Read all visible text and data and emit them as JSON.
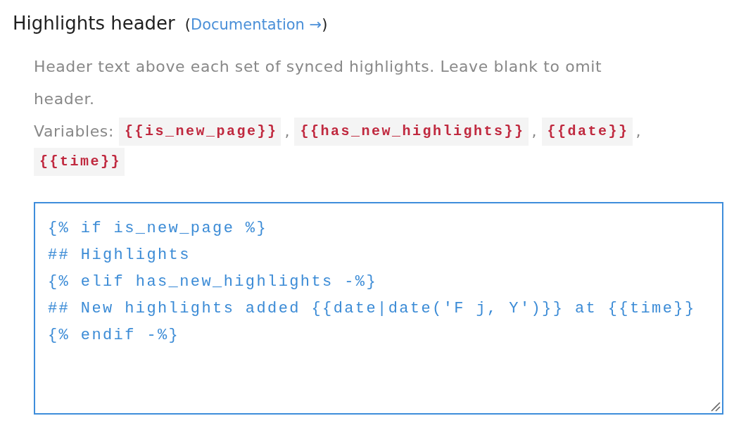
{
  "field": {
    "label": "Highlights header",
    "doc_note": {
      "before": "(",
      "link": "Documentation →",
      "after": ")"
    },
    "description": "Header text above each set of synced highlights. Leave blank to omit header.",
    "variables": {
      "label": "Variables:",
      "items": [
        {
          "code": "{{is_new_page}}",
          "separator": ","
        },
        {
          "code": "{{has_new_highlights}}",
          "separator": ","
        },
        {
          "code": "{{date}}",
          "separator": ","
        },
        {
          "code": "{{time}}"
        }
      ]
    },
    "textarea": {
      "value": "{% if is_new_page %}\n## Highlights\n{% elif has_new_highlights -%}\n## New highlights added {{date|date('F j, Y')}} at {{time}}\n{% endif -%}"
    }
  }
}
